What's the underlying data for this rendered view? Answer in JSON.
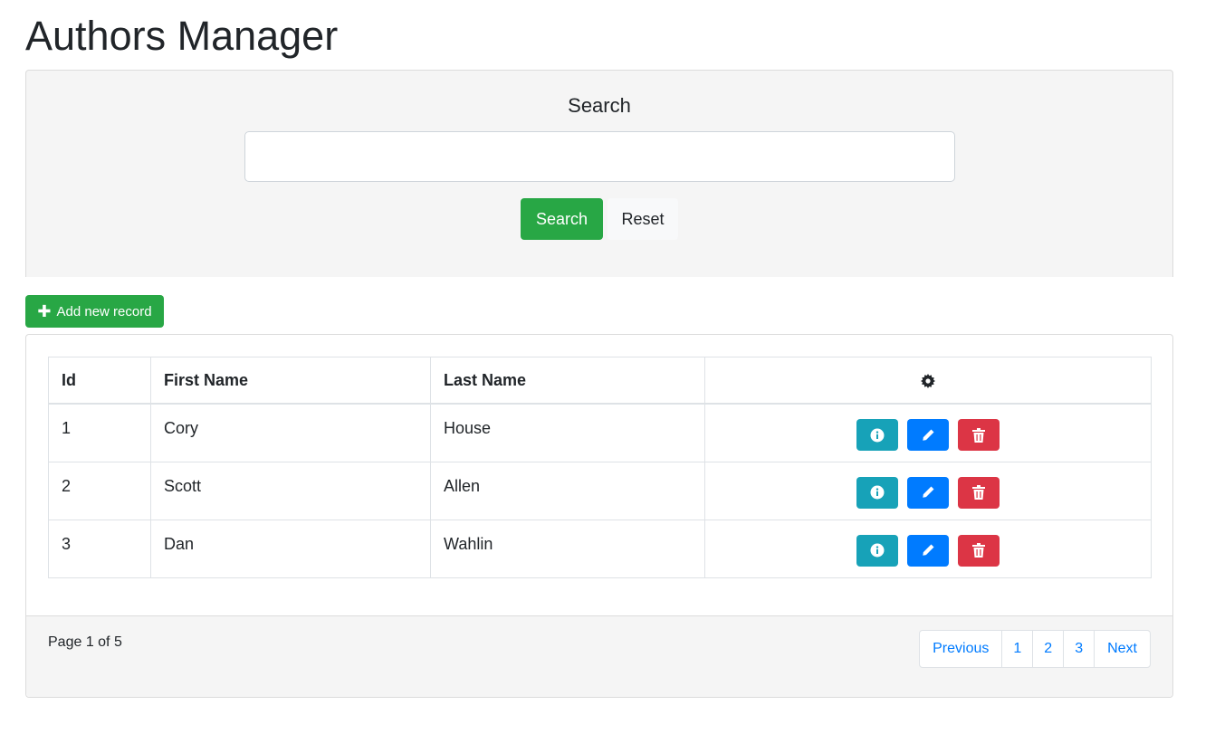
{
  "header": {
    "title": "Authors Manager"
  },
  "search": {
    "label": "Search",
    "input_value": "",
    "placeholder": "",
    "search_button": "Search",
    "reset_button": "Reset"
  },
  "toolbar": {
    "add_label": "Add new record",
    "add_icon": "plus-icon"
  },
  "table": {
    "columns": [
      "Id",
      "First Name",
      "Last Name"
    ],
    "actions_header_icon": "gear-icon",
    "rows": [
      {
        "id": "1",
        "first_name": "Cory",
        "last_name": "House"
      },
      {
        "id": "2",
        "first_name": "Scott",
        "last_name": "Allen"
      },
      {
        "id": "3",
        "first_name": "Dan",
        "last_name": "Wahlin"
      }
    ],
    "row_actions": [
      "info-icon",
      "pencil-icon",
      "trash-icon"
    ]
  },
  "footer": {
    "page_info": "Page 1 of 5",
    "pagination": {
      "previous": "Previous",
      "pages": [
        "1",
        "2",
        "3"
      ],
      "next": "Next"
    }
  },
  "colors": {
    "success": "#28a745",
    "info": "#17a2b8",
    "primary": "#007bff",
    "danger": "#dc3545",
    "panel": "#f5f5f5"
  }
}
